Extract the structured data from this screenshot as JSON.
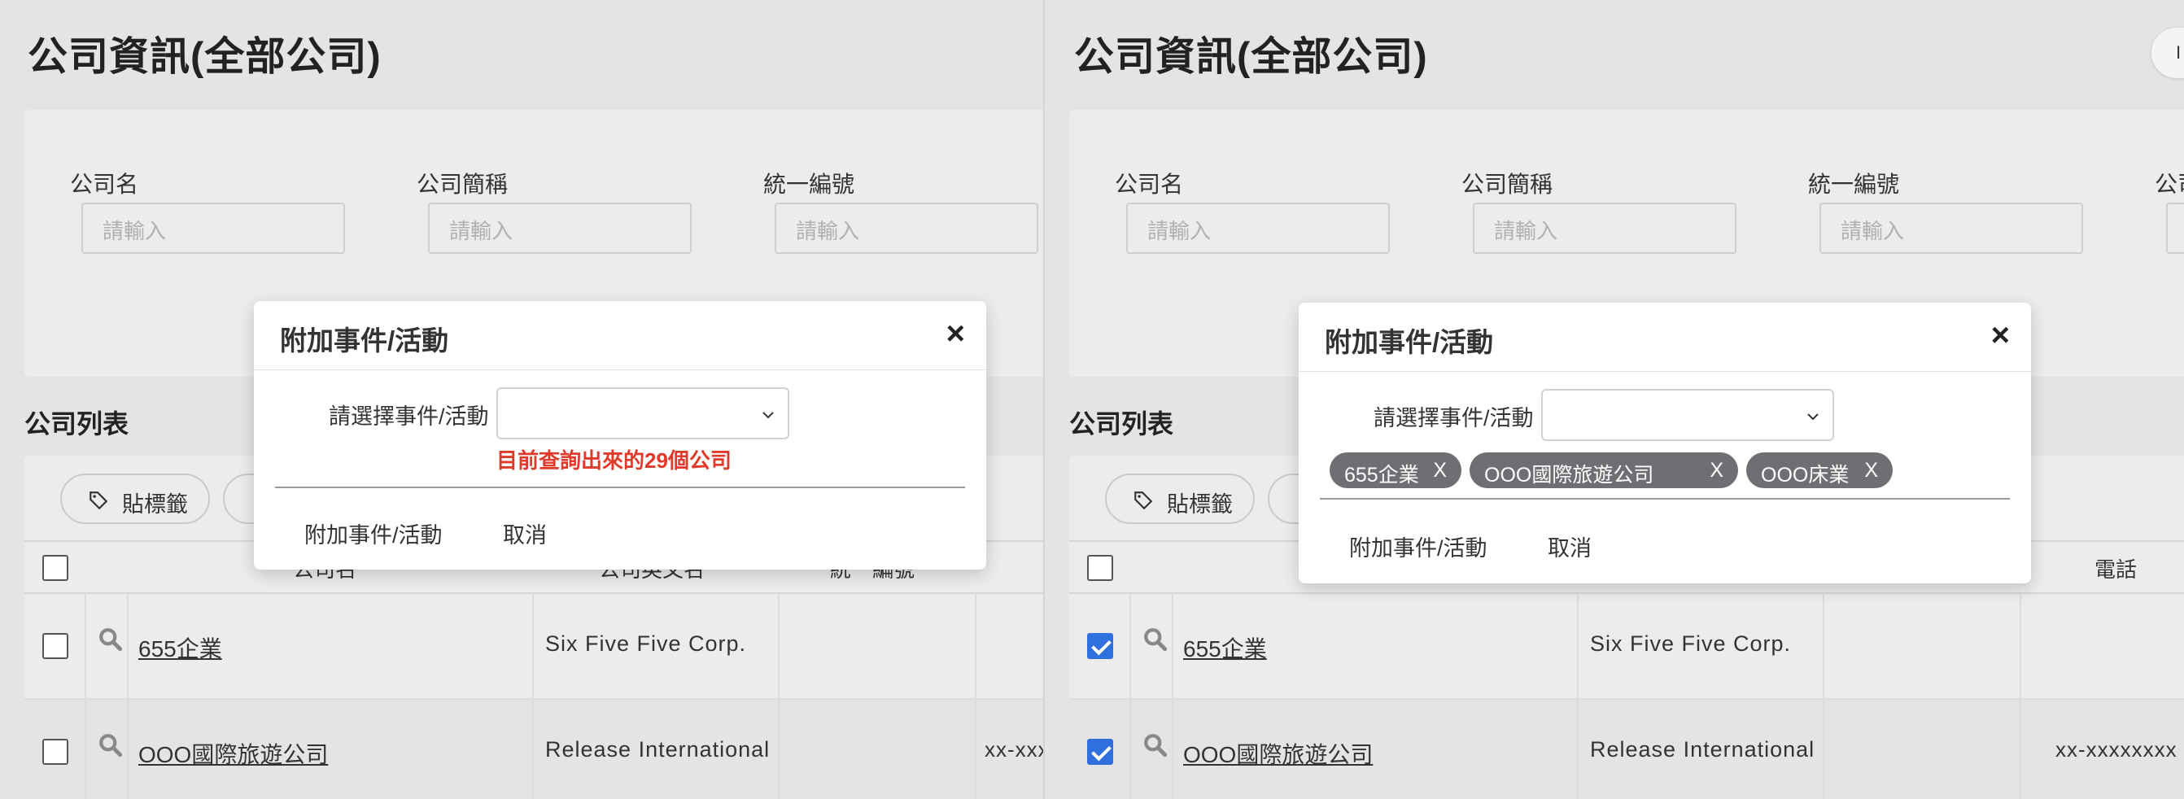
{
  "page": {
    "title": "公司資訊(全部公司)",
    "top_pill_label": "I"
  },
  "filters": [
    {
      "label": "公司名",
      "placeholder": "請輸入"
    },
    {
      "label": "公司簡稱",
      "placeholder": "請輸入"
    },
    {
      "label": "統一編號",
      "placeholder": "請輸入"
    },
    {
      "label": "公司",
      "placeholder": ""
    }
  ],
  "list": {
    "title": "公司列表",
    "tag_button_label": "貼標籤",
    "columns": {
      "name": "公司名",
      "en_name": "公司英文名",
      "tax_id": "統一編號",
      "phone": "電話"
    },
    "rows": [
      {
        "name": "655企業",
        "en_name": "Six Five Five Corp.",
        "phone": ""
      },
      {
        "name": "OOO國際旅遊公司",
        "en_name": "Release International Travel",
        "phone": "xx-xxxxxxxx"
      }
    ]
  },
  "modal": {
    "title": "附加事件/活動",
    "close_glyph": "×",
    "select_label": "請選擇事件/活動",
    "select_value": "",
    "warning_text": "目前查詢出來的29個公司",
    "submit_label": "附加事件/活動",
    "cancel_label": "取消"
  },
  "selected_chips": [
    {
      "label": "655企業",
      "remove": "X"
    },
    {
      "label": "OOO國際旅遊公司",
      "remove": "X"
    },
    {
      "label": "OOO床業",
      "remove": "X"
    }
  ],
  "state": {
    "left_rows_checked": [
      false,
      false
    ],
    "right_rows_checked": [
      true,
      true
    ]
  },
  "colors": {
    "background": "#e4e4e6",
    "card": "#ececed",
    "warning": "#e03a2b",
    "chip": "#6d6f73",
    "checkbox_checked": "#2f6fde"
  }
}
